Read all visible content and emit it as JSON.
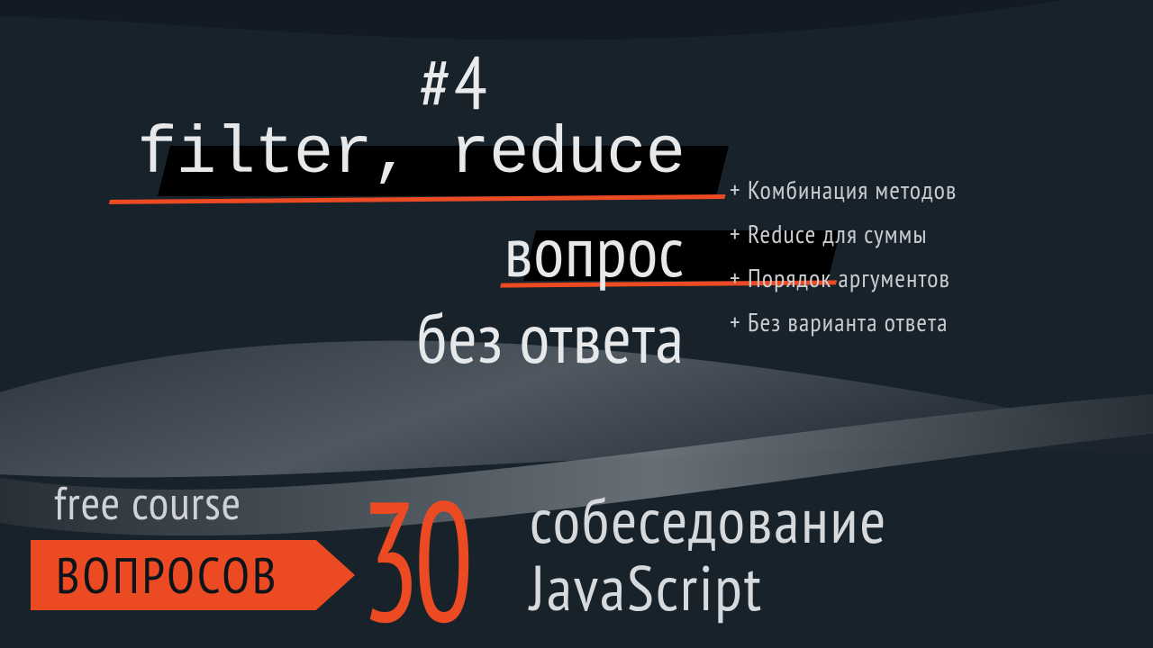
{
  "episode": "#4",
  "headline": {
    "line1": "filter, reduce",
    "line2": "вопрос",
    "line3": "без ответа"
  },
  "bullets": [
    "+ Комбинация методов",
    "+ Reduce для суммы",
    "+ Порядок аргументов",
    "+ Без варианта ответа"
  ],
  "footer": {
    "free_course": "free course",
    "tag": "ВОПРОСОВ",
    "count": "30",
    "right_line1": "собеседование",
    "right_line2": "JavaScript"
  }
}
